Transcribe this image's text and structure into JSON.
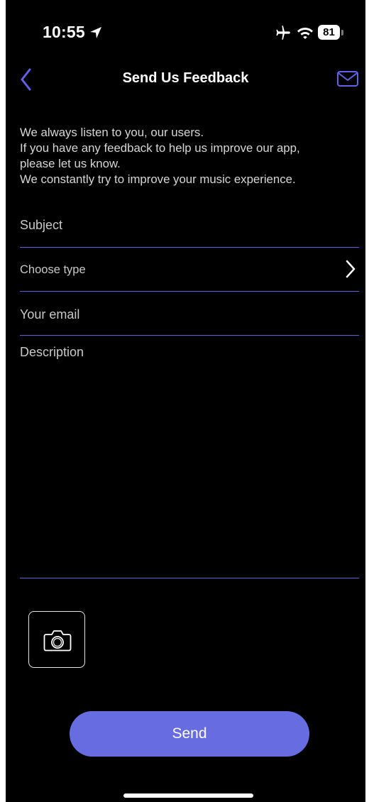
{
  "status_bar": {
    "time": "10:55",
    "battery_level": "81"
  },
  "nav": {
    "title": "Send Us Feedback",
    "back_icon": "chevron-left-icon",
    "action_icon": "mail-icon"
  },
  "intro": {
    "lines": [
      "We always listen to you, our users.",
      "If you have any feedback to help us improve our app,",
      "please let us know.",
      "We constantly try to improve your music experience."
    ]
  },
  "form": {
    "subject_placeholder": "Subject",
    "type_placeholder": "Choose type",
    "email_placeholder": "Your email",
    "description_placeholder": "Description"
  },
  "attachment": {
    "icon": "camera-icon"
  },
  "send_button": {
    "label": "Send"
  },
  "colors": {
    "background": "#000000",
    "accent": "#676ce0",
    "divider": "#5a5fe0",
    "text_primary": "#ffffff",
    "text_secondary": "#c8c8c8"
  }
}
